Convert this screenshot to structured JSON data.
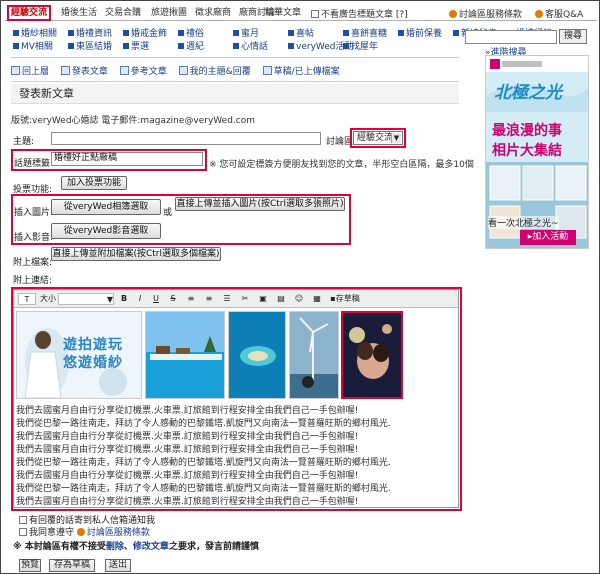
{
  "tabs": [
    {
      "label": "經驗交流",
      "active": true
    },
    {
      "label": "婚後生活",
      "active": false
    },
    {
      "label": "交易合購",
      "active": false
    },
    {
      "label": "旅遊揪團",
      "active": false
    },
    {
      "label": "徵求廠商",
      "active": false
    },
    {
      "label": "廠商討論",
      "active": false
    },
    {
      "label": "精華文章",
      "active": false
    }
  ],
  "hide_ads_label": "不看廣告標題文章 [?]",
  "top_links": {
    "terms": "討論區服務條款",
    "help": "客服Q&A"
  },
  "subnav": [
    [
      "婚紗相關",
      "婚禮資訊",
      "婚戒金飾",
      "禮俗",
      "蜜月",
      "喜帖",
      "喜餅喜糖",
      "婚前保養",
      "新娘秘書",
      "婚禮紀錄"
    ],
    [
      "MV相關",
      "東區結婚",
      "票選",
      "週紀",
      "心情話",
      "veryWed活動",
      "找屋年"
    ]
  ],
  "search": {
    "button": "搜尋",
    "advanced": "»進階搜尋"
  },
  "actions": [
    "回上層",
    "發表文章",
    "參考文章",
    "我的主題&回覆",
    "草稿/已上傳檔案"
  ],
  "form": {
    "section_title": "發表新文章",
    "board_info": "版號:veryWed心婚誌 電子郵件:magazine@veryWed.com",
    "subject_label": "主題:",
    "board_label": "討論區",
    "board_value": "經驗交流",
    "tag_label": "話題標籤:",
    "tag_value": "婚禮好正點廠稿",
    "tag_hint": "※ 您可設定標簽方便朋友找到您的文章，半形空白區隔，最多10個",
    "vote_label": "投票功能:",
    "vote_button": "加入投票功能",
    "image_label": "插入圖片:",
    "image_album_button": "從veryWed相簿選取",
    "or_label": "或",
    "image_upload_button": "直接上傳並插入圖片(按Ctrl選取多張照片)",
    "video_label": "插入影音:",
    "video_button": "從veryWed影音選取",
    "file_label": "附上檔案:",
    "file_button": "直接上傳並附加檔案(按Ctrl選取多個檔案)",
    "link_label": "附上連結:"
  },
  "editor": {
    "size_label": "大小",
    "draft_label": "存草稿",
    "banner_text": "遊拍遊玩 悠遊婚紗",
    "lines": [
      "我們去國蜜月自由行分享從訂機票.火車票.訂旅館到行程安排全由我們自己一手包辦喔!",
      "我們從巴黎一路往南走，拜訪了令人感動的巴黎鐵塔.凱旋門又向南法一覽普羅旺斯的鄉村風光.",
      "我們去國蜜月自由行分享從訂機票.火車票.訂旅館到行程安排全由我們自己一手包辦喔!",
      "我們去國蜜月自由行分享從訂機票.火車票.訂旅館到行程安排全由我們自己一手包辦喔!",
      "我們從巴黎一路往南走，拜訪了令人感動的巴黎鐵塔.凱旋門又向南法一覽普羅旺斯的鄉村風光.",
      "我們去國蜜月自由行分享從訂機票.火車票.訂旅館到行程安排全由我們自己一手包辦喔!",
      "我們從巴黎一路往南走，拜訪了令人感動的巴黎鐵塔.凱旋門又向南法一覽普羅旺斯的鄉村風光.",
      "我們去國蜜月自由行分享從訂機票.火車票.訂旅館到行程安排全由我們自己一手包辦喔!"
    ]
  },
  "options": {
    "notify": "有回覆的話寄到私人信箱通知我",
    "agree": "我同意遵守",
    "agree_link": "討論區服務條款"
  },
  "notice": {
    "prefix": "※ 本討論區有權不接受",
    "delete": "刪除",
    "sep": "、",
    "edit": "修改文章",
    "suffix": "之要求，發言前請謹慎"
  },
  "bottom_buttons": {
    "preview": "預覽",
    "save_draft": "存為草稿",
    "submit": "送出"
  },
  "ad": {
    "brand": "北極之光",
    "line1": "最浪漫的事",
    "line2": "相片大集結",
    "line3": "看一次北極之光~",
    "cta": "加入活動"
  },
  "colors": {
    "highlight_red": "#e0003a",
    "link_blue": "#1a3f8f",
    "ad_magenta": "#d0006f"
  }
}
